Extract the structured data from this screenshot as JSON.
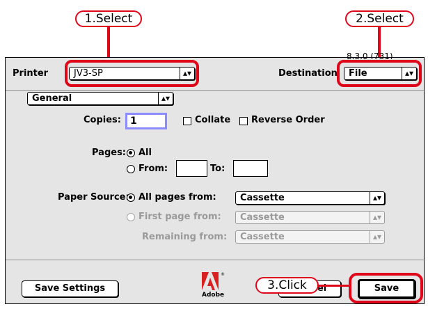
{
  "dialog": {
    "printer_label": "Printer",
    "printer_value": "JV3-SP",
    "destination_label": "Destination",
    "destination_value": "File",
    "partial_top_text": "8.3.0 (731)",
    "panel_value": "General"
  },
  "copies": {
    "label": "Copies:",
    "value": "1",
    "collate_label": "Collate",
    "reverse_label": "Reverse Order"
  },
  "pages": {
    "label": "Pages:",
    "all_label": "All",
    "from_label": "From:",
    "to_label": "To:"
  },
  "paper_source": {
    "label": "Paper Source:",
    "all_pages_from_label": "All pages from:",
    "all_pages_from_value": "Cassette",
    "first_page_from_label": "First page from:",
    "first_page_from_value": "Cassette",
    "remaining_from_label": "Remaining from:",
    "remaining_from_value": "Cassette"
  },
  "footer": {
    "save_settings_label": "Save Settings",
    "cancel_label": "Cancel",
    "save_label": "Save",
    "logo_text": "Adobe"
  },
  "callouts": {
    "step1": "1.Select",
    "step2": "2.Select",
    "step3": "3.Click"
  },
  "colors": {
    "accent_red": "#e0061a",
    "copies_focus": "#8c8cff"
  }
}
